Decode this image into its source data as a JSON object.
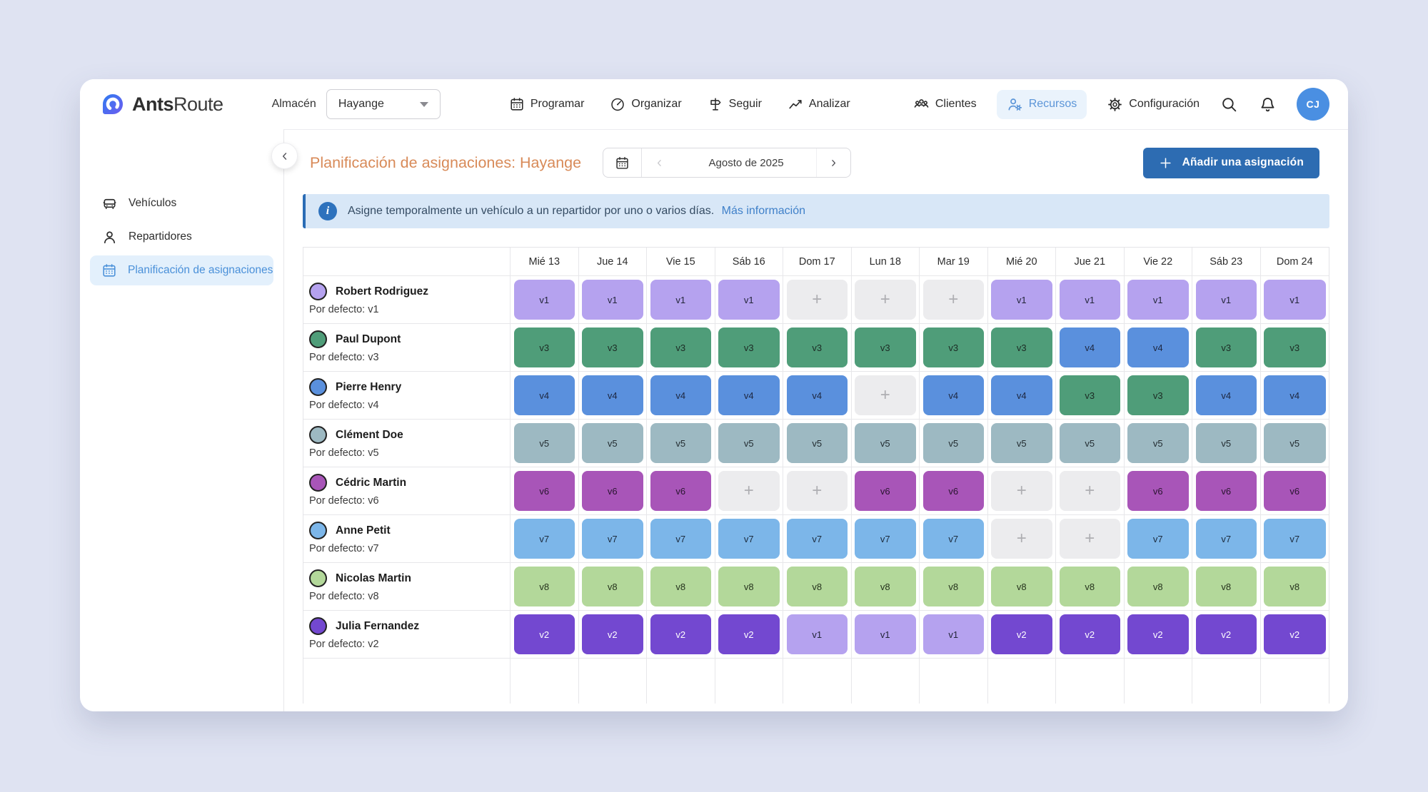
{
  "navbar": {
    "brand_bold": "Ants",
    "brand_light": "Route",
    "warehouse_label": "Almacén",
    "warehouse_value": "Hayange",
    "menu": [
      {
        "label": "Programar",
        "icon": "calendar"
      },
      {
        "label": "Organizar",
        "icon": "speedometer"
      },
      {
        "label": "Seguir",
        "icon": "signpost"
      },
      {
        "label": "Analizar",
        "icon": "chart"
      }
    ],
    "right_menu": [
      {
        "label": "Clientes",
        "icon": "people",
        "active": false
      },
      {
        "label": "Recursos",
        "icon": "person-gear",
        "active": true
      },
      {
        "label": "Configuración",
        "icon": "gear",
        "active": false
      }
    ],
    "avatar_initials": "CJ"
  },
  "sidebar": {
    "items": [
      {
        "label": "Vehículos",
        "icon": "vehicle",
        "active": false
      },
      {
        "label": "Repartidores",
        "icon": "person",
        "active": false
      },
      {
        "label": "Planificación de asignaciones",
        "icon": "calendar",
        "active": true
      }
    ]
  },
  "page": {
    "title": "Planificación de asignaciones: Hayange",
    "period_label": "Agosto de 2025",
    "add_button_label": "Añadir una asignación",
    "banner_text": "Asigne temporalmente un vehículo a un repartidor por uno o varios días.",
    "banner_link": "Más información"
  },
  "schedule": {
    "days": [
      "Mié 13",
      "Jue 14",
      "Vie 15",
      "Sáb 16",
      "Dom 17",
      "Lun 18",
      "Mar 19",
      "Mié 20",
      "Jue 21",
      "Vie 22",
      "Sáb 23",
      "Dom 24"
    ],
    "default_prefix": "Por defecto:",
    "vehicle_colors": {
      "v1": {
        "bg": "#b5a2ef",
        "fg": "#23263a"
      },
      "v2": {
        "bg": "#7348d0",
        "fg": "#ffffff"
      },
      "v3": {
        "bg": "#4f9d79",
        "fg": "#1c2b24"
      },
      "v4": {
        "bg": "#5a90dd",
        "fg": "#1d2740"
      },
      "v5": {
        "bg": "#9db9c2",
        "fg": "#242e33"
      },
      "v6": {
        "bg": "#a855b8",
        "fg": "#2a1530"
      },
      "v7": {
        "bg": "#7cb6e9",
        "fg": "#1c2b3d"
      },
      "v8": {
        "bg": "#b3d89a",
        "fg": "#26331d"
      }
    },
    "empty_cell": {
      "bg": "#ececee",
      "plus_color": "#aeaeb2"
    },
    "rows": [
      {
        "name": "Robert Rodriguez",
        "default_vehicle": "v1",
        "cells": [
          "v1",
          "v1",
          "v1",
          "v1",
          null,
          null,
          null,
          "v1",
          "v1",
          "v1",
          "v1",
          "v1"
        ]
      },
      {
        "name": "Paul Dupont",
        "default_vehicle": "v3",
        "cells": [
          "v3",
          "v3",
          "v3",
          "v3",
          "v3",
          "v3",
          "v3",
          "v3",
          "v4",
          "v4",
          "v3",
          "v3"
        ]
      },
      {
        "name": "Pierre Henry",
        "default_vehicle": "v4",
        "cells": [
          "v4",
          "v4",
          "v4",
          "v4",
          "v4",
          null,
          "v4",
          "v4",
          "v3",
          "v3",
          "v4",
          "v4"
        ]
      },
      {
        "name": "Clément Doe",
        "default_vehicle": "v5",
        "cells": [
          "v5",
          "v5",
          "v5",
          "v5",
          "v5",
          "v5",
          "v5",
          "v5",
          "v5",
          "v5",
          "v5",
          "v5"
        ]
      },
      {
        "name": "Cédric Martin",
        "default_vehicle": "v6",
        "cells": [
          "v6",
          "v6",
          "v6",
          null,
          null,
          "v6",
          "v6",
          null,
          null,
          "v6",
          "v6",
          "v6"
        ]
      },
      {
        "name": "Anne Petit",
        "default_vehicle": "v7",
        "cells": [
          "v7",
          "v7",
          "v7",
          "v7",
          "v7",
          "v7",
          "v7",
          null,
          null,
          "v7",
          "v7",
          "v7"
        ]
      },
      {
        "name": "Nicolas Martin",
        "default_vehicle": "v8",
        "cells": [
          "v8",
          "v8",
          "v8",
          "v8",
          "v8",
          "v8",
          "v8",
          "v8",
          "v8",
          "v8",
          "v8",
          "v8"
        ]
      },
      {
        "name": "Julia Fernandez",
        "default_vehicle": "v2",
        "cells": [
          "v2",
          "v2",
          "v2",
          "v2",
          "v1",
          "v1",
          "v1",
          "v2",
          "v2",
          "v2",
          "v2",
          "v2"
        ]
      }
    ]
  },
  "colors": {
    "page_background": "#dfe3f2",
    "title_orange": "#d88a58",
    "primary_button_blue": "#2d6cb2",
    "active_nav_blue": "#5b95d8",
    "banner_background": "#d8e7f7",
    "banner_border": "#2a6cb5",
    "avatar_background": "#4a8fe2"
  }
}
